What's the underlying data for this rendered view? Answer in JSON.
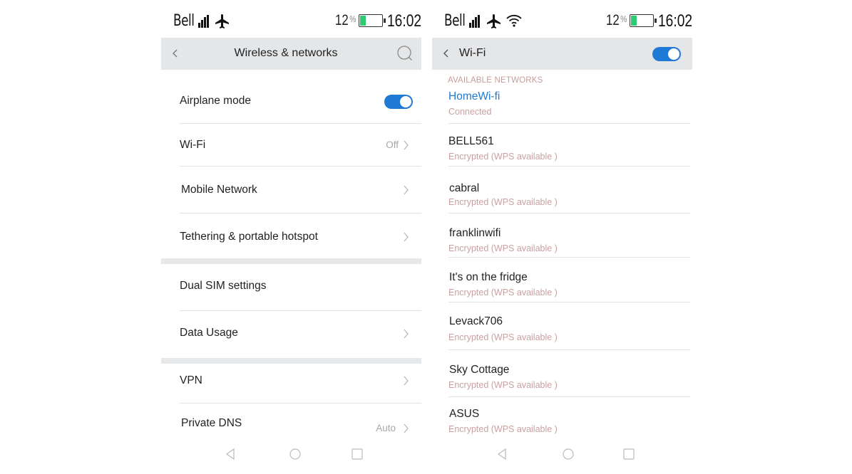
{
  "status_bar": {
    "carrier": "Bell",
    "battery_percent": "12",
    "percent_sign": "%",
    "time": "16:02",
    "battery_level": 0.12,
    "battery_color": "#2ecc71"
  },
  "left_screen": {
    "title": "Wireless & networks",
    "airplane_mode": {
      "label": "Airplane mode",
      "enabled": true
    },
    "wifi": {
      "label": "Wi-Fi",
      "value": "Off"
    },
    "mobile_network": {
      "label": "Mobile Network"
    },
    "tethering": {
      "label": "Tethering & portable hotspot"
    },
    "dual_sim": {
      "label": "Dual SIM settings"
    },
    "data_usage": {
      "label": "Data Usage"
    },
    "vpn": {
      "label": "VPN"
    },
    "private_dns": {
      "label": "Private DNS",
      "value": "Auto"
    }
  },
  "right_screen": {
    "title": "Wi-Fi",
    "wifi_enabled": true,
    "section_label": "AVAILABLE NETWORKS",
    "networks": [
      {
        "ssid": "HomeWi-fi",
        "status": "Connected"
      },
      {
        "ssid": "BELL561",
        "status": "Encrypted (WPS available )"
      },
      {
        "ssid": "cabral",
        "status": "Encrypted (WPS available )"
      },
      {
        "ssid": "franklinwifi",
        "status": "Encrypted (WPS available )"
      },
      {
        "ssid": "It's on the fridge",
        "status": "Encrypted (WPS available )"
      },
      {
        "ssid": "Levack706",
        "status": "Encrypted (WPS available )"
      },
      {
        "ssid": "Sky Cottage",
        "status": "Encrypted (WPS available )"
      },
      {
        "ssid": "ASUS",
        "status": "Encrypted (WPS available )"
      }
    ]
  },
  "icons": {
    "signal": "signal-icon",
    "airplane": "airplane-icon",
    "wifi": "wifi-icon",
    "battery": "battery-icon",
    "back": "back-arrow-icon",
    "search": "search-icon",
    "chevron": "chevron-right-icon",
    "nav_back": "nav-back-icon",
    "nav_home": "nav-home-icon",
    "nav_recents": "nav-recents-icon"
  },
  "colors": {
    "accent": "#1f7ad6",
    "app_bar_bg": "#e4e6e8",
    "subtitle": "#c9a0a0",
    "battery": "#2ecc71"
  }
}
